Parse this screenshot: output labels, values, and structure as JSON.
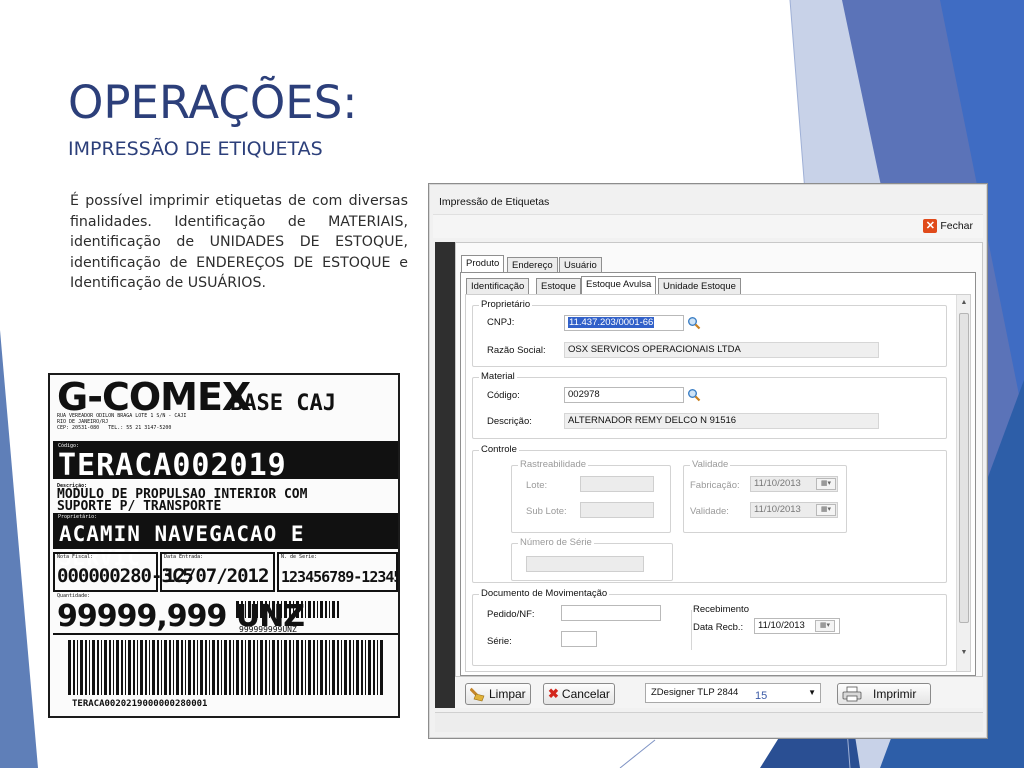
{
  "slide": {
    "title": "OPERAÇÕES:",
    "subtitle": "IMPRESSÃO DE ETIQUETAS",
    "body": "É possível imprimir etiquetas de com diversas finalidades. Identificação de MATERIAIS, identificação de UNIDADES DE ESTOQUE, identificação de ENDEREÇOS DE ESTOQUE e Identificação de USUÁRIOS.",
    "page_number": "15"
  },
  "colors": {
    "title": "#2c3f7a",
    "accent_blue": "#3a6fb0",
    "accent_navy": "#1f3a6b",
    "selection": "#3261c9"
  },
  "label_image": {
    "logo": "G-COMEX",
    "base": "BASE CAJ",
    "code": "TERACA002019",
    "description_line1": "MODULO DE PROPULSAO INTERIOR  COM",
    "description_line2": "SUPORTE P/ TRANSPORTE",
    "owner": "ACAMIN NAVEGACAO E SERVIC",
    "nota_fiscal": "000000280-3C5",
    "data_entrada": "12/07/2012",
    "numero_serie": "123456789-12345",
    "quantidade": "99999,999 UNZ",
    "quantidade_barcode_text": "999999999UNZ",
    "bottom_code": "TERACA0020219000000280001"
  },
  "window": {
    "title": "Impressão de Etiquetas",
    "close_label": "Fechar",
    "outer_tabs": [
      "Produto",
      "Endereço",
      "Usuário"
    ],
    "inner_tabs": [
      "Identificação",
      "Estoque",
      "Estoque Avulsa",
      "Unidade Estoque"
    ],
    "proprietario": {
      "legend": "Proprietário",
      "cnpj_label": "CNPJ:",
      "cnpj_value": "11.437.203/0001-66",
      "razao_label": "Razão Social:",
      "razao_value": "OSX SERVICOS OPERACIONAIS LTDA"
    },
    "material": {
      "legend": "Material",
      "codigo_label": "Código:",
      "codigo_value": "002978",
      "descricao_label": "Descrição:",
      "descricao_value": "ALTERNADOR REMY DELCO N 91516"
    },
    "controle": {
      "legend": "Controle",
      "rastreabilidade_legend": "Rastreabilidade",
      "lote_label": "Lote:",
      "sublote_label": "Sub Lote:",
      "validade_legend": "Validade",
      "fabricacao_label": "Fabricação:",
      "fabricacao_value": "11/10/2013",
      "validade_label": "Validade:",
      "validade_value": "11/10/2013",
      "numero_serie_legend": "Número de Série"
    },
    "documento": {
      "legend": "Documento de Movimentação",
      "pedido_label": "Pedido/NF:",
      "serie_label": "Série:",
      "recebimento_legend": "Recebimento",
      "data_receb_label": "Data Recb.:",
      "data_receb_value": "11/10/2013"
    },
    "buttons": {
      "limpar": "Limpar",
      "cancelar": "Cancelar",
      "imprimir": "Imprimir"
    },
    "printer": "ZDesigner TLP 2844"
  }
}
